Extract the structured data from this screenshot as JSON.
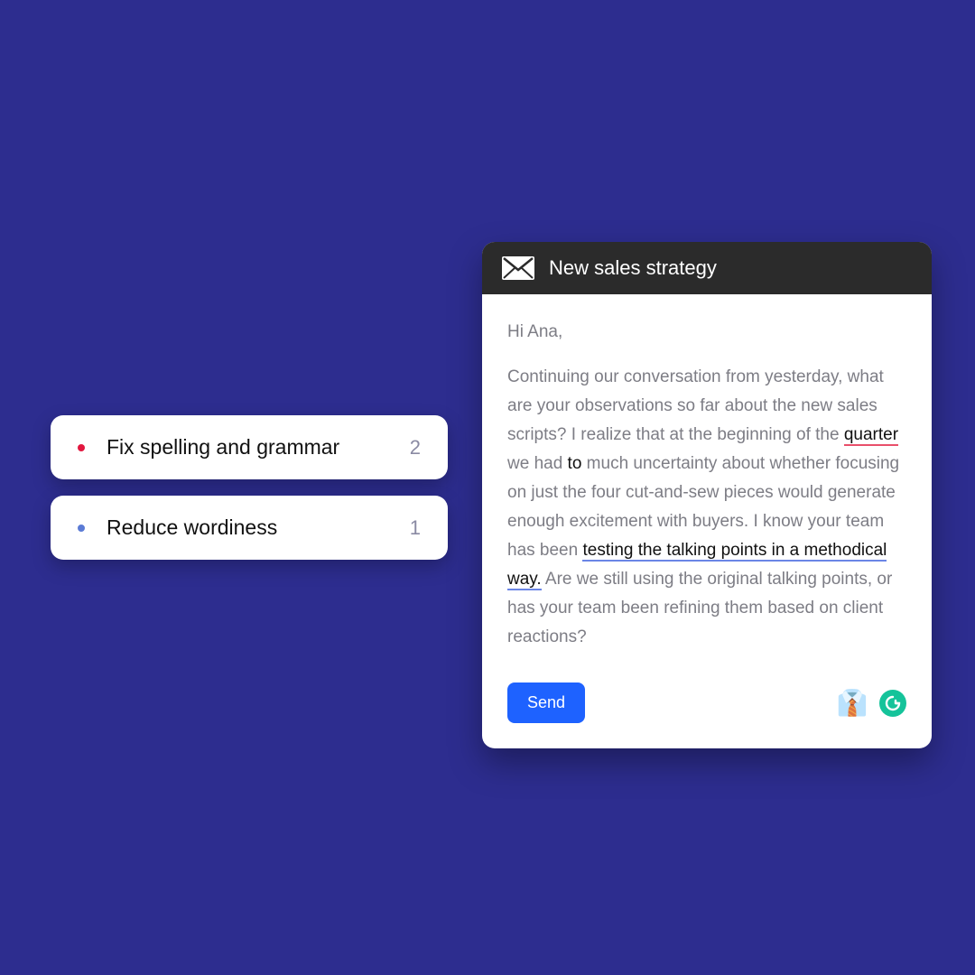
{
  "suggestions": [
    {
      "label": "Fix spelling and grammar",
      "count": "2",
      "dot_color": "red"
    },
    {
      "label": "Reduce wordiness",
      "count": "1",
      "dot_color": "blue"
    }
  ],
  "email": {
    "subject": "New sales strategy",
    "greeting": "Hi Ana,",
    "body": {
      "p1_a": "Continuing our conversation from yesterday, what are your observations so far about the new sales scripts? I realize that at the beginning of the ",
      "word_quarter": "quarter",
      "p1_b": " we had ",
      "word_to": "to",
      "p1_c": " much uncertainty about whether focusing on just the four cut-and-sew pieces would generate enough excitement with buyers. I know your team has been ",
      "phrase_methodical": "testing the talking points in a methodical way.",
      "p1_d": " Are we still using the original talking points, or has your team been refining them based on client reactions?"
    },
    "send_label": "Send"
  }
}
